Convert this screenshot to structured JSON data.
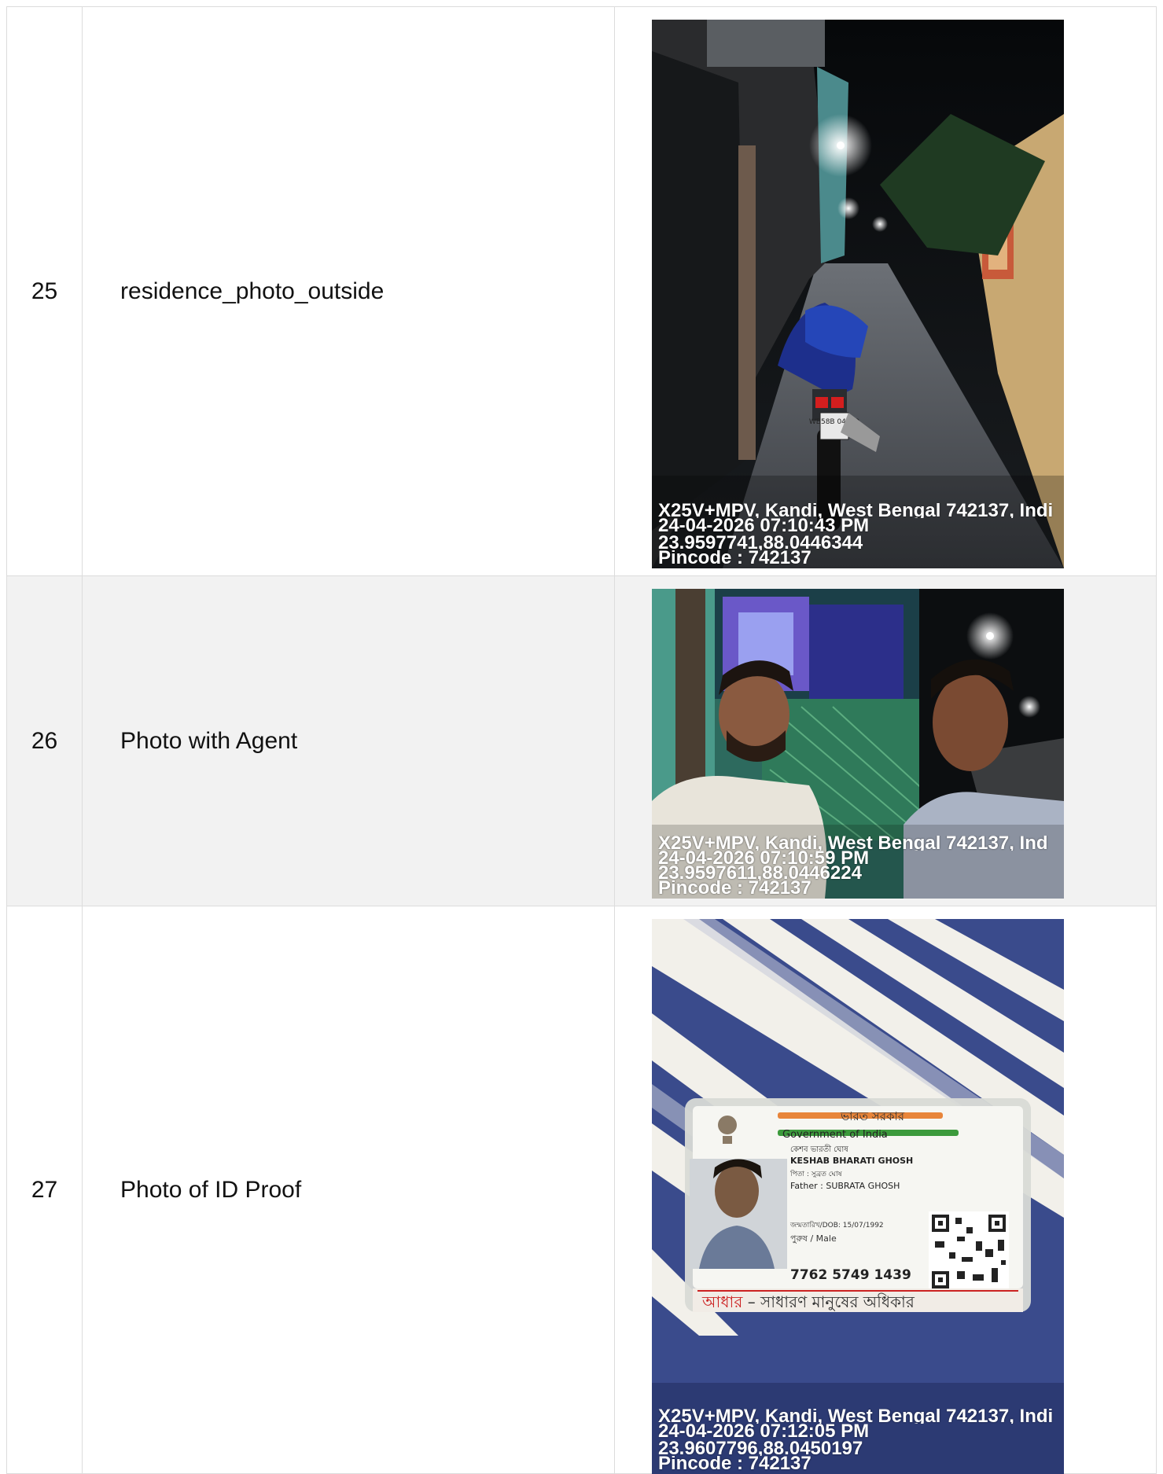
{
  "rows": [
    {
      "index": "25",
      "label": "residence_photo_outside",
      "photo": {
        "name": "residence-photo-outside",
        "address": "X25V+MPV, Kandi, West Bengal 742137, Indi",
        "datetime": "24-04-2026 07:10:43 PM",
        "coords": "23.9597741,88.0446344",
        "pincode": "Pincode : 742137",
        "motorcycle_plate": "WB58B 04199"
      }
    },
    {
      "index": "26",
      "label": "Photo with Agent",
      "photo": {
        "name": "photo-with-agent",
        "address": "X25V+MPV, Kandi, West Bengal 742137, Ind",
        "datetime": "24-04-2026 07:10:59 PM",
        "coords": "23.9597611,88.0446224",
        "pincode": "Pincode : 742137"
      }
    },
    {
      "index": "27",
      "label": "Photo of ID Proof",
      "photo": {
        "name": "photo-of-id-proof",
        "address": "X25V+MPV, Kandi, West Bengal 742137, Indi",
        "datetime": "24-04-2026 07:12:05 PM",
        "coords": "23.9607796,88.0450197",
        "pincode": "Pincode : 742137",
        "id_card": {
          "header_bn": "ভারত সরকার",
          "header_en": "Government of India",
          "name_bn": "কেশব ভারতী ঘোষ",
          "name_en": "KESHAB BHARATI GHOSH",
          "father_bn": "পিতা : সুব্রত ঘোষ",
          "father_en": "Father : SUBRATA GHOSH",
          "dob": "জন্মতারিখ/DOB: 15/07/1992",
          "gender": "পুরুষ / Male",
          "number": "7762 5749 1439",
          "footer_bn_red": "আধার",
          "footer_bn_rest": " – সাধারণ মানুষের অধিকার"
        }
      }
    }
  ],
  "colors": {
    "row_alt_bg": "#f2f2f2",
    "border": "#dcdcdc",
    "saffron": "#e8853a",
    "green": "#3c9a3c",
    "footer_red": "#cc2222"
  }
}
